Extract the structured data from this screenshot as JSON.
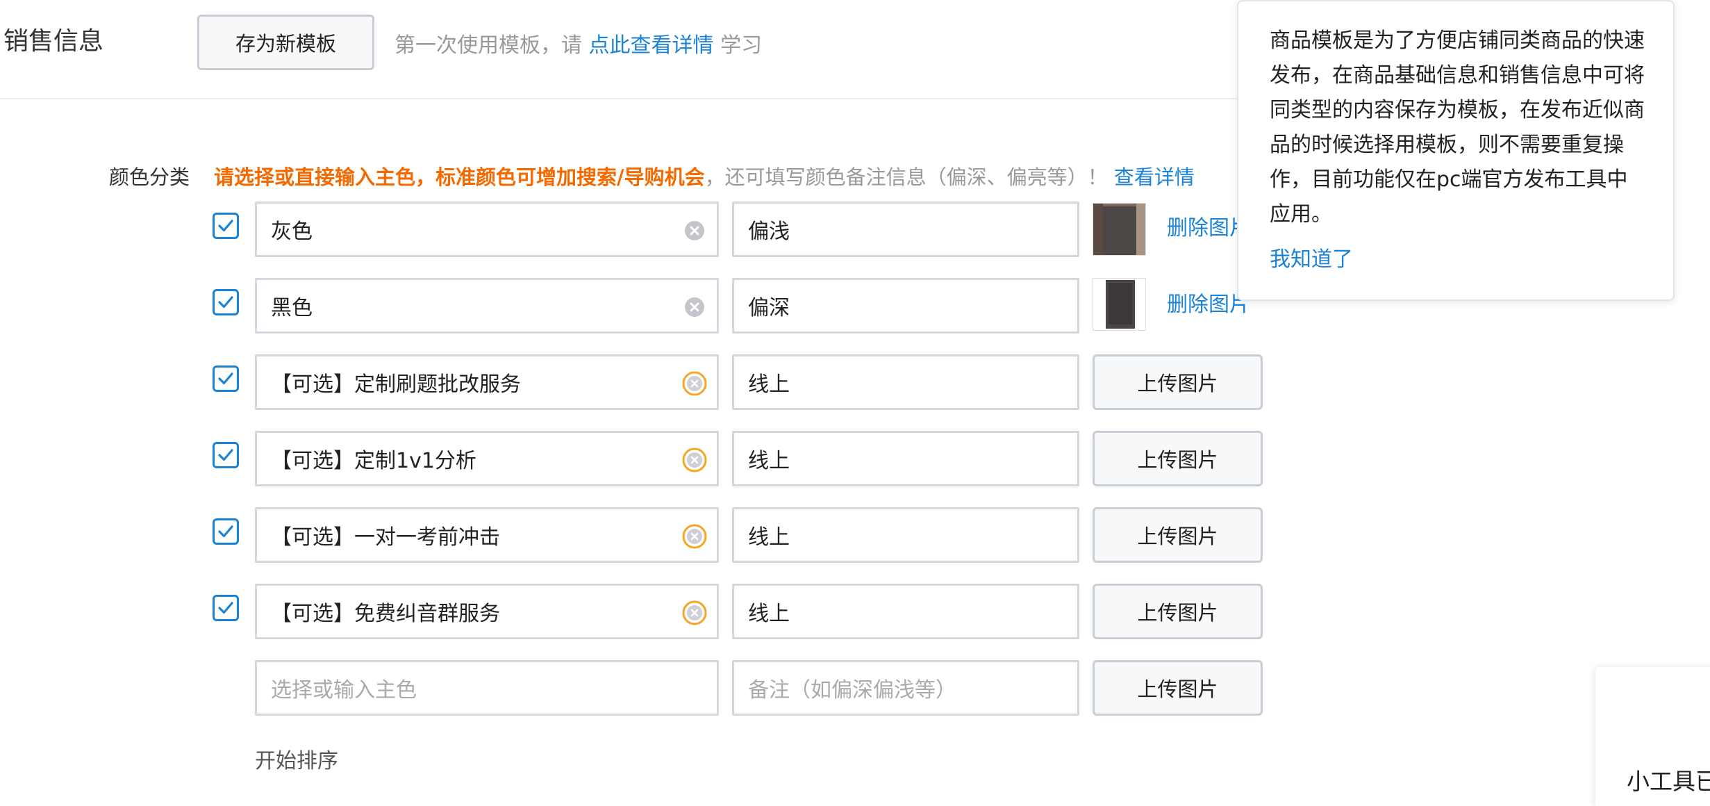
{
  "section": {
    "title": "销售信息",
    "save_template_button": "存为新模板",
    "hint_prefix": "第一次使用模板，请 ",
    "hint_link": "点此查看详情",
    "hint_suffix": " 学习"
  },
  "color_category": {
    "label": "颜色分类",
    "tip_warning": "请选择或直接输入主色，标准颜色可增加搜索/导购机会",
    "tip_rest": "，还可填写颜色备注信息（偏深、偏亮等）！",
    "tip_link": "查看详情",
    "rows": [
      {
        "checked": true,
        "main": "灰色",
        "note": "偏浅",
        "action": "删除图片"
      },
      {
        "checked": true,
        "main": "黑色",
        "note": "偏深",
        "action": "删除图片"
      },
      {
        "checked": true,
        "main": "【可选】定制刷题批改服务",
        "note": "线上",
        "action": "上传图片"
      },
      {
        "checked": true,
        "main": "【可选】定制1v1分析",
        "note": "线上",
        "action": "上传图片"
      },
      {
        "checked": true,
        "main": "【可选】一对一考前冲击",
        "note": "线上",
        "action": "上传图片"
      },
      {
        "checked": true,
        "main": "【可选】免费纠音群服务",
        "note": "线上",
        "action": "上传图片"
      }
    ],
    "new_row": {
      "main_placeholder": "选择或输入主色",
      "note_placeholder": "备注（如偏深偏浅等）",
      "action": "上传图片"
    },
    "sort_label": "开始排序"
  },
  "popover": {
    "lines": [
      "商品模板是为了方便店铺同类商品的快速",
      "发布，在商品基础信息和销售信息中可将",
      "同类型的内容保存为模板，在发布近似商",
      "品的时候选择用模板，则不需要重复操",
      "作，目前功能仅在pc端官方发布工具中",
      "应用。"
    ],
    "ok_link": "我知道了"
  },
  "side_panel": {
    "text": "小工具已"
  },
  "colors": {
    "accent": "#1a83d6",
    "warning": "#f56a00",
    "clear_orange": "#f5a623"
  }
}
